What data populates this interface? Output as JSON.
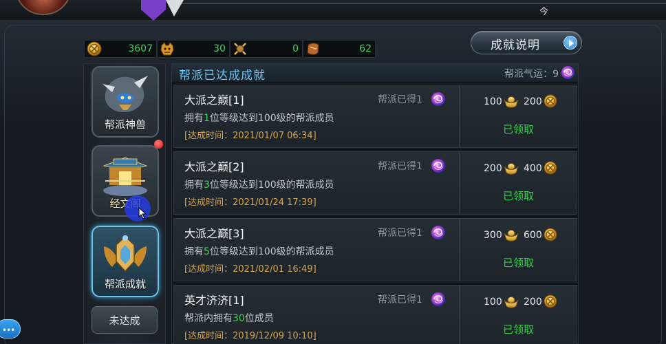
{
  "top": {
    "glyph": "今"
  },
  "currencies": [
    {
      "icon": "gold-coin-icon",
      "value": "3607"
    },
    {
      "icon": "beast-head-icon",
      "value": "30"
    },
    {
      "icon": "crossed-swords-badge-icon",
      "value": "0"
    },
    {
      "icon": "scroll-token-icon",
      "value": "62"
    }
  ],
  "explain_button": {
    "label": "成就说明"
  },
  "side_tabs": [
    {
      "label": "帮派神兽",
      "icon": "guild-beast-icon",
      "active": false
    },
    {
      "label": "经文阁",
      "icon": "scripture-pavilion-icon",
      "active": false,
      "has_notification": true
    },
    {
      "label": "帮派成就",
      "icon": "guild-achievement-emblem-icon",
      "active": true
    }
  ],
  "unfinished_button": {
    "label": "未达成"
  },
  "list": {
    "title": "帮派已达成成就",
    "morale_label": "帮派气运：9",
    "morale_icon": "swirl-orb-icon"
  },
  "achievements": [
    {
      "name": "大派之巅[1]",
      "desc_pre": "拥有",
      "desc_num": "1",
      "desc_post": "位等级达到100级的帮派成员",
      "time": "[达成时间：2021/01/07  06:34]",
      "gained": "帮派已得1",
      "reward1": "100",
      "reward2": "200",
      "status": "已领取"
    },
    {
      "name": "大派之巅[2]",
      "desc_pre": "拥有",
      "desc_num": "3",
      "desc_post": "位等级达到100级的帮派成员",
      "time": "[达成时间：2021/01/24  17:39]",
      "gained": "帮派已得1",
      "reward1": "200",
      "reward2": "400",
      "status": "已领取"
    },
    {
      "name": "大派之巅[3]",
      "desc_pre": "拥有",
      "desc_num": "5",
      "desc_post": "位等级达到100级的帮派成员",
      "time": "[达成时间：2021/02/01  16:49]",
      "gained": "帮派已得1",
      "reward1": "300",
      "reward2": "600",
      "status": "已领取"
    },
    {
      "name": "英才济济[1]",
      "desc_pre": "帮派内拥有",
      "desc_num": "30",
      "desc_post": "位成员",
      "time": "[达成时间：2019/12/09  10:10]",
      "gained": "帮派已得1",
      "reward1": "100",
      "reward2": "200",
      "status": "已领取"
    }
  ],
  "reward_icons": {
    "first": "gold-ingot-icon",
    "second": "gold-coin-icon"
  },
  "chat_button": {
    "label": "•••"
  },
  "colors": {
    "highlight_green": "#43d25a",
    "claimed_green": "#37d24c",
    "time_gold": "#d6a74d",
    "title_blue": "#6fc4f2",
    "active_tab_border": "#6ec3e8"
  }
}
